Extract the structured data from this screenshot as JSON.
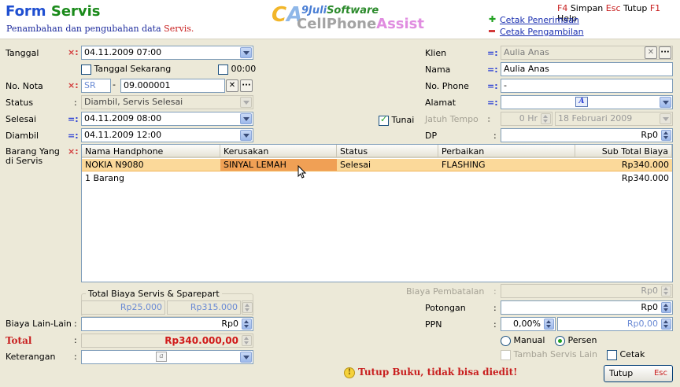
{
  "header": {
    "title_part1": "Form",
    "title_part2": "Servis",
    "subtitle_part1": "Penambahan dan pengubahan data",
    "subtitle_part2": "Servis.",
    "logo_initials_c": "C",
    "logo_initials_a": "A",
    "logo_top_j": "9Juli",
    "logo_top_s": "Software",
    "logo_main_a": "CellPhone",
    "logo_main_b": "Assist",
    "shortcuts": [
      {
        "key": "F4",
        "label": "Simpan"
      },
      {
        "key": "Esc",
        "label": "Tutup"
      },
      {
        "key": "F1",
        "label": "Help"
      }
    ],
    "link_print_receipt": "Cetak Penerimaan",
    "link_print_pickup": "Cetak Pengambilan"
  },
  "form": {
    "tanggal_label": "Tanggal",
    "tanggal_value": "04.11.2009 07:00",
    "tanggal_sekarang_label": "Tanggal Sekarang",
    "time_00_label": "00:00",
    "nota_label": "No. Nota",
    "nota_prefix": "SR",
    "nota_value": "09.000001",
    "status_label": "Status",
    "status_value": "Diambil, Servis Selesai",
    "selesai_label": "Selesai",
    "selesai_value": "04.11.2009 08:00",
    "tunai_label": "Tunai",
    "diambil_label": "Diambil",
    "diambil_value": "04.11.2009 12:00",
    "barang_label": "Barang Yang di  Servis",
    "klien_label": "Klien",
    "klien_value": "Aulia Anas",
    "nama_label": "Nama",
    "nama_value": "Aulia Anas",
    "phone_label": "No. Phone",
    "phone_value": "-",
    "alamat_label": "Alamat",
    "jatuh_tempo_label": "Jatuh Tempo",
    "jatuh_tempo_days": "0 Hr",
    "jatuh_tempo_date": "18 Februari 2009",
    "dp_label": "DP",
    "dp_value": "Rp0"
  },
  "grid": {
    "columns": [
      "Nama Handphone",
      "Kerusakan",
      "Status",
      "Perbaikan",
      "Sub Total Biaya"
    ],
    "rows": [
      [
        "NOKIA N9080",
        "SINYAL LEMAH",
        "Selesai",
        "FLASHING",
        "Rp340.000"
      ]
    ],
    "footer_count": "1 Barang",
    "footer_total": "Rp340.000"
  },
  "totals": {
    "legend": "Total Biaya Servis & Sparepart",
    "servis_value": "Rp25.000",
    "sparepart_value": "Rp315.000",
    "biaya_lain_label": "Biaya Lain-Lain",
    "biaya_lain_value": "Rp0",
    "total_label": "Total",
    "total_value": "Rp340.000,00",
    "keterangan_label": "Keterangan",
    "biaya_pembatalan_label": "Biaya Pembatalan",
    "biaya_pembatalan_value": "Rp0",
    "potongan_label": "Potongan",
    "potongan_value": "Rp0",
    "ppn_label": "PPN",
    "ppn_percent": "0,00%",
    "ppn_value": "Rp0,00",
    "manual_label": "Manual",
    "persen_label": "Persen",
    "tambah_label": "Tambah Servis Lain",
    "cetak_label": "Cetak"
  },
  "footer": {
    "warning": "Tutup Buku, tidak bisa diedit!",
    "close_label": "Tutup",
    "close_key": "Esc"
  },
  "marks": {
    "req": "×:",
    "opt": "=:",
    "plain": ":"
  }
}
